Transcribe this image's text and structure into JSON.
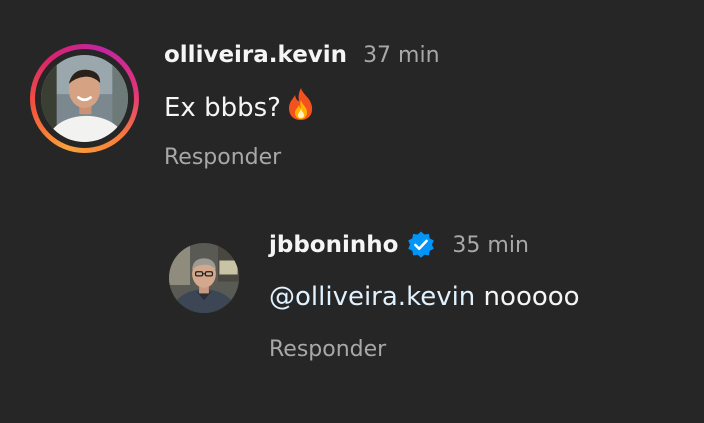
{
  "comments": [
    {
      "username": "olliveira.kevin",
      "time": "37 min",
      "text": "Ex bbbs?",
      "emoji_icon": "fire-emoji",
      "reply_label": "Responder",
      "avatar_icon": "avatar",
      "has_story_ring": true
    },
    {
      "username": "jbboninho",
      "verified": true,
      "verified_icon": "verified-badge-icon",
      "time": "35 min",
      "mention": "@olliveira.kevin",
      "text": " nooooo",
      "reply_label": "Responder",
      "avatar_icon": "avatar"
    }
  ],
  "colors": {
    "background": "#262626",
    "primary_text": "#f5f5f5",
    "secondary_text": "#a8a8a8",
    "mention": "#e0f1ff",
    "verified_blue": "#0095f6"
  }
}
